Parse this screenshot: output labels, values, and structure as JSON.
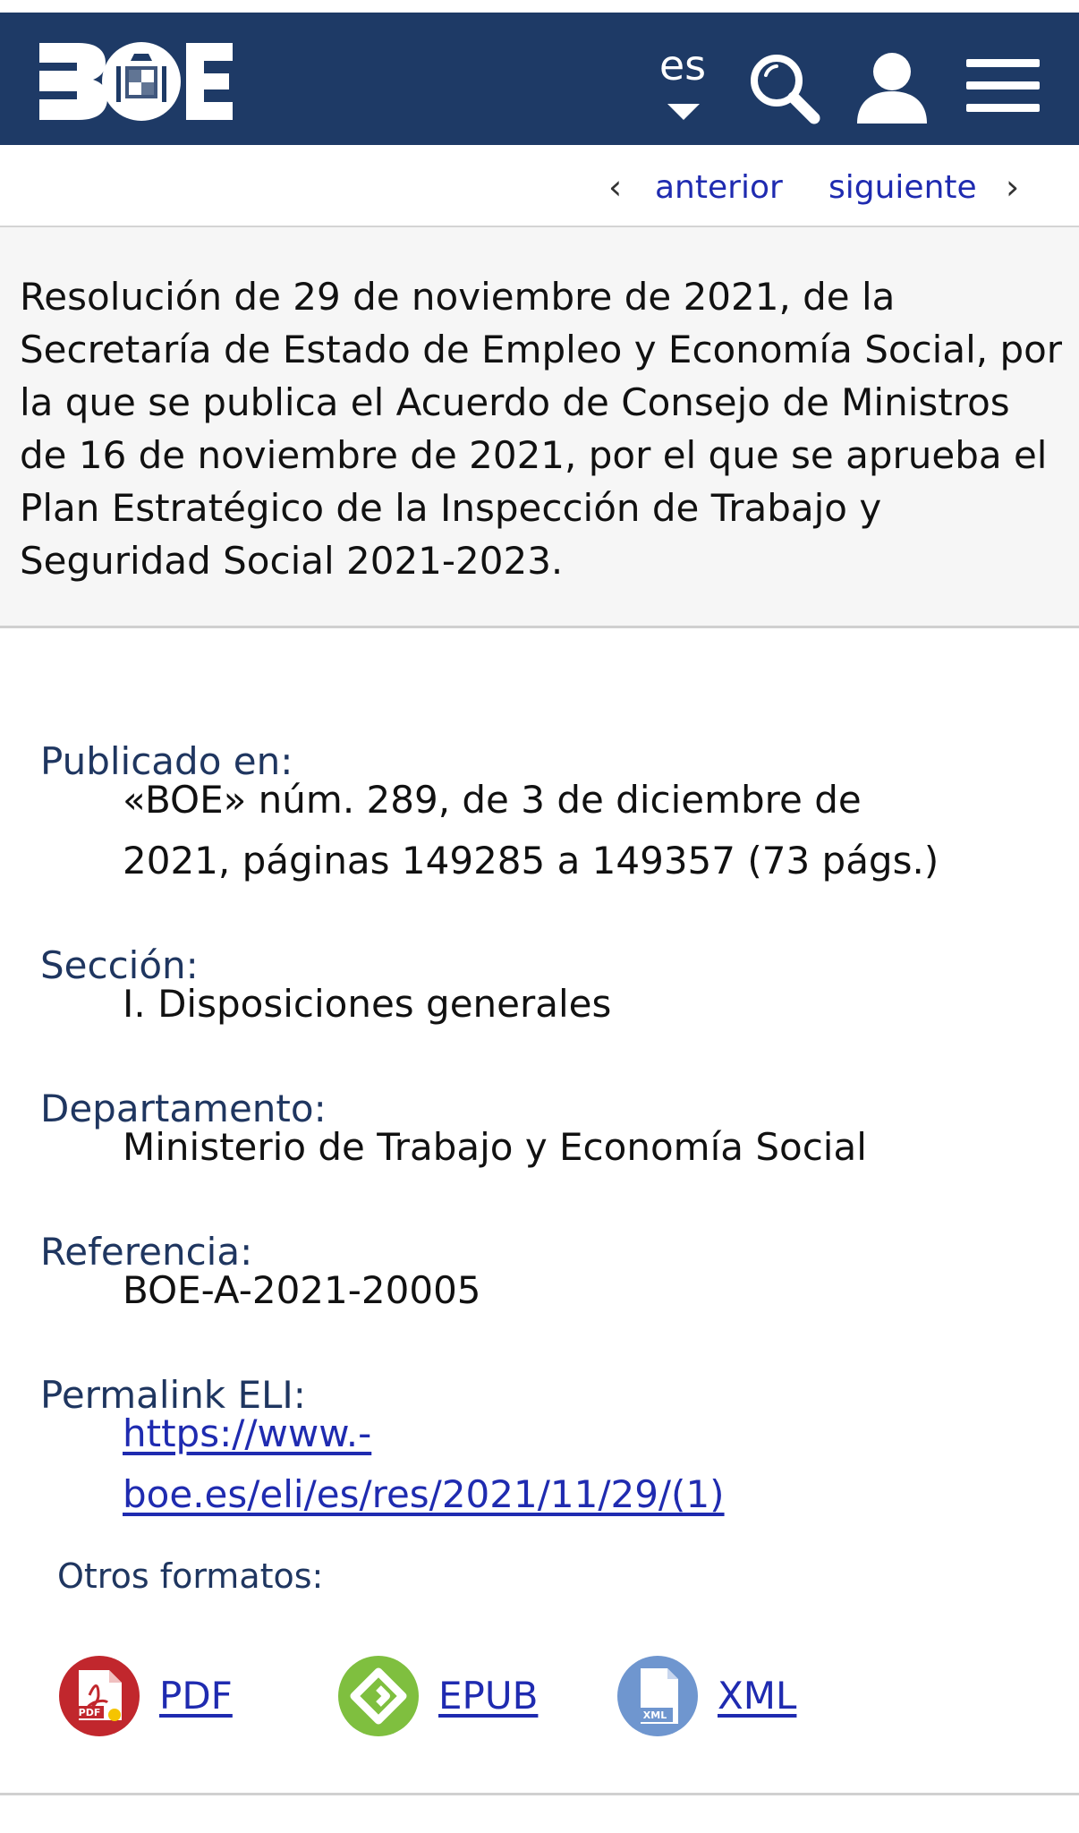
{
  "header": {
    "logo_alt": "BOE",
    "language": "es",
    "colors": {
      "background": "#1e3a66",
      "icons": "#ffffff"
    },
    "icons": {
      "search": "search-icon",
      "user": "user-icon",
      "menu": "menu-icon",
      "caret": "caret-down-icon"
    }
  },
  "pager": {
    "previous": "anterior",
    "next": "siguiente"
  },
  "document": {
    "title": "Resolución de 29 de noviembre de 2021, de la Secretaría de Estado de Empleo y Economía Social, por la que se publica el Acuerdo de Consejo de Ministros de 16 de noviembre de 2021, por el que se aprueba el Plan Estratégico de la Inspección de Trabajo y Seguridad Social 2021-2023."
  },
  "metadata": {
    "published_label": "Publicado en:",
    "published_line1": "«BOE» núm. 289, de 3 de diciembre de",
    "published_line2": "2021, páginas 149285 a 149357 (73 págs.)",
    "section_label": "Sección:",
    "section_value": "I. Disposiciones generales",
    "department_label": "Departamento:",
    "department_value": "Ministerio de Trabajo y Economía Social",
    "reference_label": "Referencia:",
    "reference_value": "BOE-A-2021-20005",
    "permalink_label": "Permalink ELI:",
    "permalink_line1": "https://www.-",
    "permalink_line2": "boe.es/eli/es/res/2021/11/29/(1)"
  },
  "formats": {
    "label": "Otros formatos:",
    "items": [
      {
        "label": "PDF",
        "icon": "pdf-icon",
        "color": "#c1272d"
      },
      {
        "label": "EPUB",
        "icon": "epub-icon",
        "color": "#7fbf3f"
      },
      {
        "label": "XML",
        "icon": "xml-icon",
        "color": "#6f96cf"
      }
    ]
  }
}
